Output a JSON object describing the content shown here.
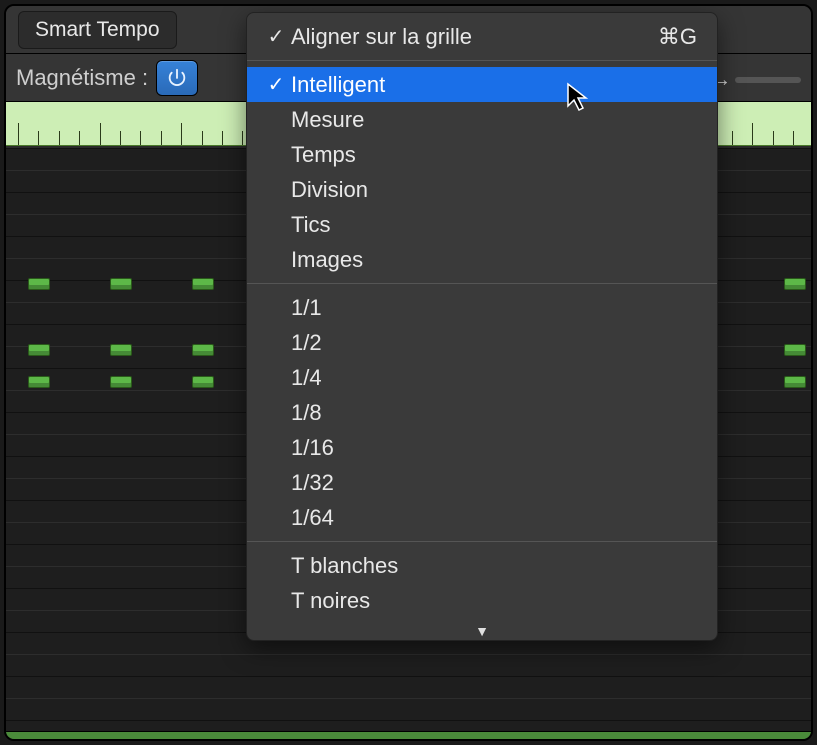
{
  "header": {
    "smart_tempo_label": "Smart Tempo",
    "magnetism_label": "Magnétisme :",
    "snap_menu_shortcut": "⌘G"
  },
  "menu": {
    "snap_to_grid": {
      "label": "Aligner sur la grille",
      "checked": true
    },
    "mode_items": [
      {
        "id": "intelligent",
        "label": "Intelligent",
        "checked": true,
        "highlighted": true
      },
      {
        "id": "mesure",
        "label": "Mesure",
        "checked": false
      },
      {
        "id": "temps",
        "label": "Temps",
        "checked": false
      },
      {
        "id": "division",
        "label": "Division",
        "checked": false
      },
      {
        "id": "tics",
        "label": "Tics",
        "checked": false
      },
      {
        "id": "images",
        "label": "Images",
        "checked": false
      }
    ],
    "division_items": [
      {
        "id": "1-1",
        "label": "1/1"
      },
      {
        "id": "1-2",
        "label": "1/2"
      },
      {
        "id": "1-4",
        "label": "1/4"
      },
      {
        "id": "1-8",
        "label": "1/8"
      },
      {
        "id": "1-16",
        "label": "1/16"
      },
      {
        "id": "1-32",
        "label": "1/32"
      },
      {
        "id": "1-64",
        "label": "1/64"
      }
    ],
    "triplet_items": [
      {
        "id": "t-blanches",
        "label": "T blanches"
      },
      {
        "id": "t-noires",
        "label": "T noires"
      }
    ]
  },
  "colors": {
    "highlight": "#1a6fe8",
    "note_fill": "#5db848",
    "ruler_bg": "#cdeeb5"
  }
}
